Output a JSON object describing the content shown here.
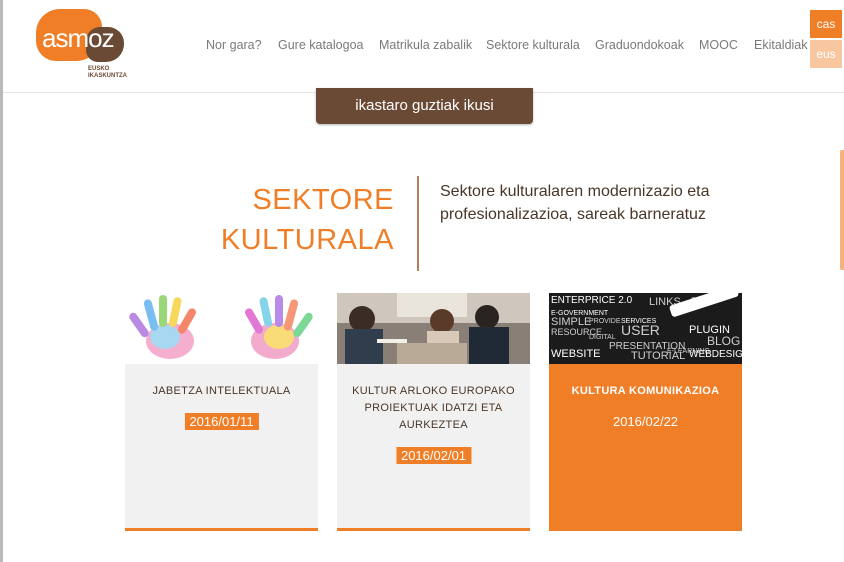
{
  "logo": {
    "wordmark": "asmoz",
    "subtitle_line1": "EUSKO",
    "subtitle_line2": "IKASKUNTZA"
  },
  "nav": {
    "items": [
      "Nor gara?",
      "Gure katalogoa",
      "Matrikula zabalik",
      "Sektore kulturala",
      "Graduondokoak",
      "MOOC",
      "Ekitaldiak"
    ]
  },
  "lang": {
    "cas": "cas",
    "eus": "eus"
  },
  "cta": {
    "label": "ikastaro guztiak ikusi"
  },
  "section": {
    "title_line1": "SEKTORE",
    "title_line2": "KULTURALA",
    "description": "Sektore kulturalaren modernizazio eta profesionalizazioa, sareak barneratuz"
  },
  "cards": [
    {
      "title": "JABETZA INTELEKTUALA",
      "date": "2016/01/11",
      "image": "painted-hands-image"
    },
    {
      "title": "KULTUR ARLOKO EUROPAKO PROIEKTUAK IDATZI ETA AURKEZTEA",
      "date": "2016/02/01",
      "image": "team-meeting-image"
    },
    {
      "title": "KULTURA KOMUNIKAZIOA",
      "date": "2016/02/22",
      "image": "chalkboard-words-image"
    }
  ],
  "chalkboard_words": [
    "ENTERPRICE 2.0",
    "LINKS",
    "SEARCH",
    "E-GOVERNMENT",
    "SIMPLE",
    "PROVIDE",
    "SERVICES",
    "RESOURCE",
    "USER",
    "PLUGIN",
    "DIGITAL",
    "PRESENTATION",
    "WEBSITE",
    "TUTORIAL",
    "E-LEARNING",
    "WEBDESIGN",
    "BLOG"
  ],
  "colors": {
    "accent": "#f07e26",
    "brown": "#6b4a35",
    "card_bg": "#f1f1f1"
  }
}
